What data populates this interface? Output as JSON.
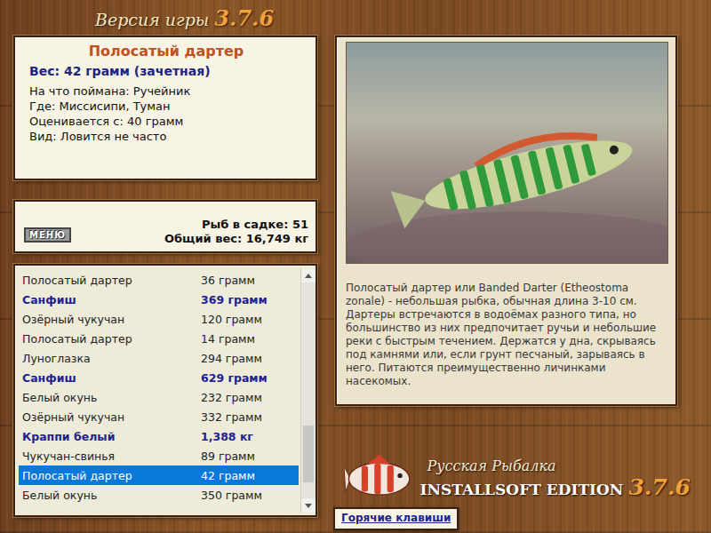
{
  "title": {
    "label": "Версия игры",
    "version": "3.7.6"
  },
  "fish_card": {
    "name": "Полосатый дартер",
    "weight": "Вес: 42 грамм (зачетная)",
    "details": [
      "На что поймана: Ручейник",
      "Где: Миссисипи, Туман",
      "Оценивается с: 40 грамм",
      "Вид: Ловится не часто"
    ]
  },
  "summary": {
    "menu_button": "МЕНЮ",
    "count": "Рыб в садке: 51",
    "total": "Общий вес: 16,749 кг"
  },
  "catch_list": {
    "rows": [
      {
        "name": "Полосатый дартер",
        "weight": "36 грамм",
        "highlighted": false,
        "selected": false
      },
      {
        "name": "Санфиш",
        "weight": "369 грамм",
        "highlighted": true,
        "selected": false
      },
      {
        "name": "Озёрный чукучан",
        "weight": "120 грамм",
        "highlighted": false,
        "selected": false
      },
      {
        "name": "Полосатый дартер",
        "weight": "14 грамм",
        "highlighted": false,
        "selected": false
      },
      {
        "name": "Луноглазка",
        "weight": "294 грамм",
        "highlighted": false,
        "selected": false
      },
      {
        "name": "Санфиш",
        "weight": "629 грамм",
        "highlighted": true,
        "selected": false
      },
      {
        "name": "Белый окунь",
        "weight": "232 грамм",
        "highlighted": false,
        "selected": false
      },
      {
        "name": "Озёрный чукучан",
        "weight": "332 грамм",
        "highlighted": false,
        "selected": false
      },
      {
        "name": "Краппи белый",
        "weight": "1,388 кг",
        "highlighted": true,
        "selected": false
      },
      {
        "name": "Чукучан-свинья",
        "weight": "89 грамм",
        "highlighted": false,
        "selected": false
      },
      {
        "name": "Полосатый дартер",
        "weight": "42 грамм",
        "highlighted": false,
        "selected": true
      },
      {
        "name": "Белый окунь",
        "weight": "350 грамм",
        "highlighted": false,
        "selected": false
      }
    ],
    "scroll_level": 0.9
  },
  "description": "Полосатый дартер или Banded Darter (Etheostoma zonale) - небольшая рыбка, обычная длина 3-10 см. Дартеры встречаются в водоёмах разного типа, но большинство из них предпочитает ручьи и небольшие реки с быстрым течением. Держатся у дна, скрываясь под камнями или, если грунт песчаный, зарываясь в него. Питаются преимущественно личинками насекомых.",
  "logo": {
    "title": "Русская Рыбалка",
    "edition": "INSTALLSOFT EDITION",
    "version": "3.7.6"
  },
  "hotkeys_button": "Горячие клавиши"
}
